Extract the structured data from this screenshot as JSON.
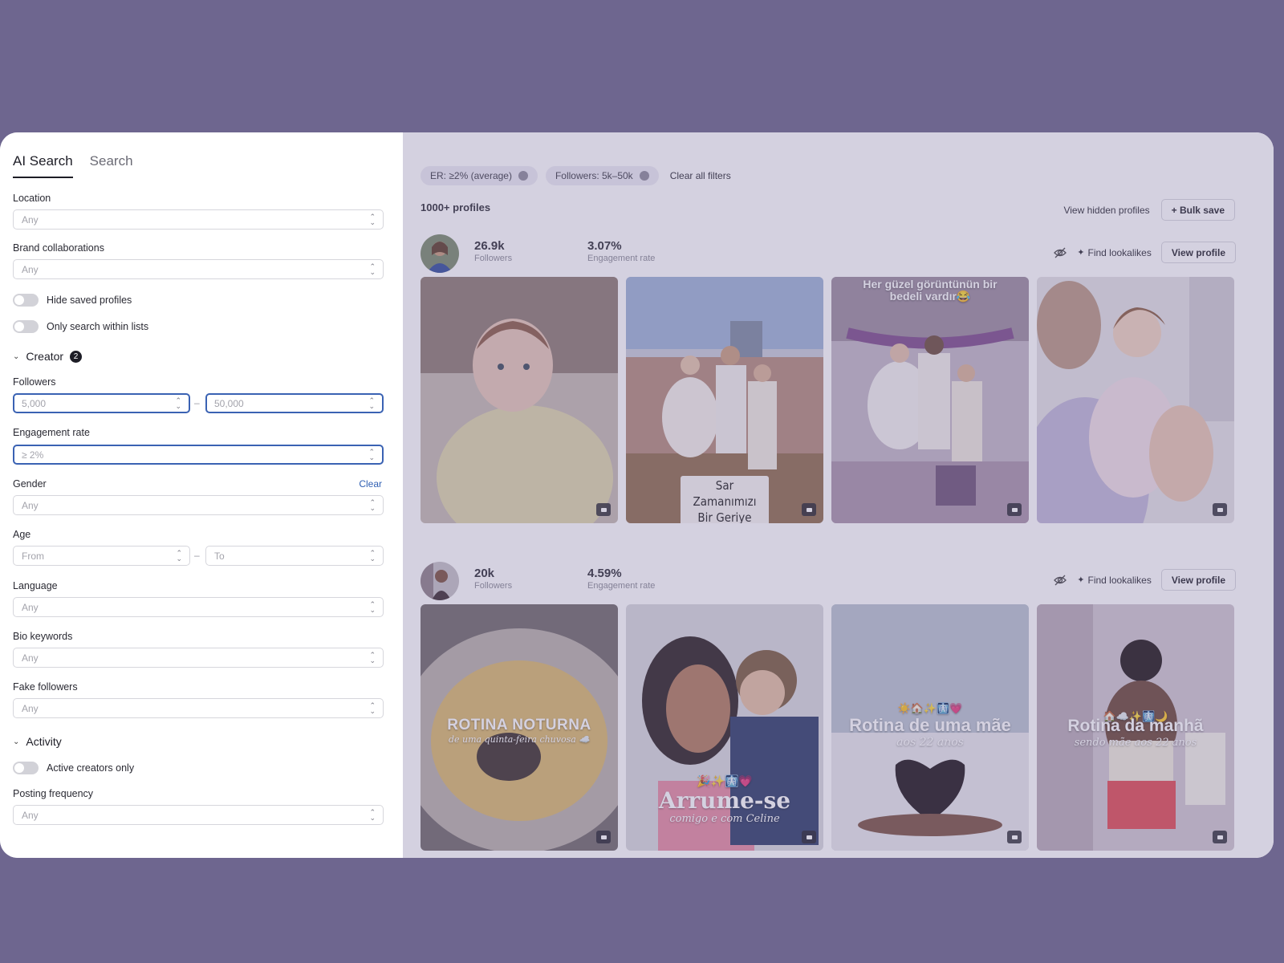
{
  "tabs": [
    {
      "label": "AI Search"
    },
    {
      "label": "Search"
    }
  ],
  "sidebar": {
    "location": {
      "label": "Location",
      "value": "Any"
    },
    "brand": {
      "label": "Brand collaborations",
      "value": "Any"
    },
    "hide_saved": "Hide saved profiles",
    "only_lists": "Only search within lists",
    "creator_section": {
      "label": "Creator",
      "badge": "2"
    },
    "followers": {
      "label": "Followers",
      "from": "5,000",
      "to": "50,000",
      "sep": "–"
    },
    "engagement": {
      "label": "Engagement rate",
      "value": "≥ 2%"
    },
    "gender": {
      "label": "Gender",
      "clear": "Clear",
      "value": "Any"
    },
    "age": {
      "label": "Age",
      "from": "From",
      "to": "To",
      "sep": "–"
    },
    "language": {
      "label": "Language",
      "value": "Any"
    },
    "bio": {
      "label": "Bio keywords",
      "value": "Any"
    },
    "fake": {
      "label": "Fake followers",
      "value": "Any"
    },
    "activity_section": {
      "label": "Activity"
    },
    "active_only": "Active creators only",
    "posting": {
      "label": "Posting frequency",
      "value": "Any"
    }
  },
  "filters": {
    "chips": [
      {
        "label": "ER: ≥2% (average)"
      },
      {
        "label": "Followers: 5k–50k"
      }
    ],
    "clear_all": "Clear all filters"
  },
  "results": {
    "count": "1000+ profiles",
    "view_hidden": "View hidden profiles",
    "bulk_save": "+ Bulk save"
  },
  "creators": [
    {
      "followers": "26.9k",
      "followers_label": "Followers",
      "er": "3.07%",
      "er_label": "Engagement rate",
      "find": "Find lookalikes",
      "view": "View profile",
      "captions": [
        "",
        "Sar Zamanımızı\nBir Geriye",
        "Her güzel görüntünün bir\nbedeli vardır😂",
        ""
      ]
    },
    {
      "followers": "20k",
      "followers_label": "Followers",
      "er": "4.59%",
      "er_label": "Engagement rate",
      "find": "Find lookalikes",
      "view": "View profile",
      "captions": [
        {
          "title": "ROTINA NOTURNA",
          "sub": "de uma quinta-feira chuvosa ☁️"
        },
        {
          "title": "Arrume-se",
          "sub": "comigo e com Celine",
          "emoji": "🎉✨🩻💗"
        },
        {
          "title": "Rotina de uma mãe",
          "sub": "aos 22 anos",
          "emoji": "☀️🏠✨🩻💗"
        },
        {
          "title": "Rotina da manhã",
          "sub": "sendo mãe aos 22 anos",
          "emoji": "🏠☁️✨🩻🌙"
        }
      ]
    }
  ],
  "colors": {
    "accent": "#3a62b3",
    "background": "#6e668f",
    "dark": "#1d1d26"
  }
}
